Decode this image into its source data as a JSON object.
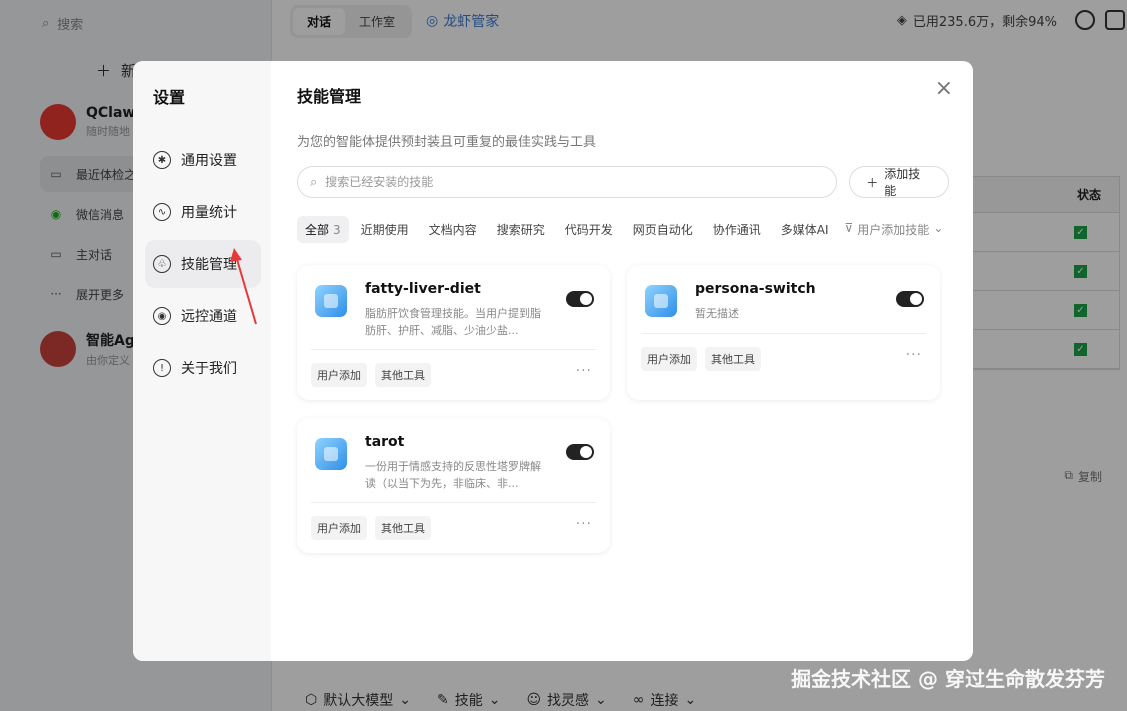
{
  "app": {
    "search_placeholder": "搜索",
    "new_label": "新",
    "agents": [
      {
        "name": "QClaw",
        "desc": "随时随地"
      },
      {
        "name": "智能Ag",
        "desc": "由你定义"
      }
    ],
    "sidebar_items": [
      "最近体检之",
      "微信消息",
      "主对话",
      "展开更多"
    ],
    "top_tabs": [
      "对话",
      "工作室"
    ],
    "brand": "龙虾管家",
    "quota": "已用235.6万，剩余94%",
    "table_header": "状态",
    "copy_label": "复制",
    "bottom_bar": [
      "默认大模型",
      "技能",
      "找灵感",
      "连接"
    ]
  },
  "modal": {
    "nav_title": "设置",
    "nav_items": [
      {
        "label": "通用设置",
        "icon": "gear-icon"
      },
      {
        "label": "用量统计",
        "icon": "chart-icon"
      },
      {
        "label": "技能管理",
        "icon": "skill-icon"
      },
      {
        "label": "远控通道",
        "icon": "remote-icon"
      },
      {
        "label": "关于我们",
        "icon": "info-icon"
      }
    ],
    "title": "技能管理",
    "subtitle": "为您的智能体提供预封装且可重复的最佳实践与工具",
    "search_placeholder": "搜索已经安装的技能",
    "add_button": "添加技能",
    "filters": {
      "all_label": "全部",
      "all_count": "3",
      "tabs": [
        "近期使用",
        "文档内容",
        "搜索研究",
        "代码开发",
        "网页自动化",
        "协作通讯",
        "多媒体AI"
      ],
      "user_added": "用户添加技能"
    },
    "skills": [
      {
        "name": "fatty-liver-diet",
        "desc": "脂肪肝饮食管理技能。当用户提到脂肪肝、护肝、减脂、少油少盐...",
        "enabled": true,
        "tags": [
          "用户添加",
          "其他工具"
        ]
      },
      {
        "name": "persona-switch",
        "desc": "暂无描述",
        "enabled": true,
        "tags": [
          "用户添加",
          "其他工具"
        ]
      },
      {
        "name": "tarot",
        "desc": "一份用于情感支持的反思性塔罗牌解读（以当下为先，非临床、非...",
        "enabled": true,
        "tags": [
          "用户添加",
          "其他工具"
        ]
      }
    ]
  },
  "watermark": "掘金技术社区 @ 穿过生命散发芬芳"
}
